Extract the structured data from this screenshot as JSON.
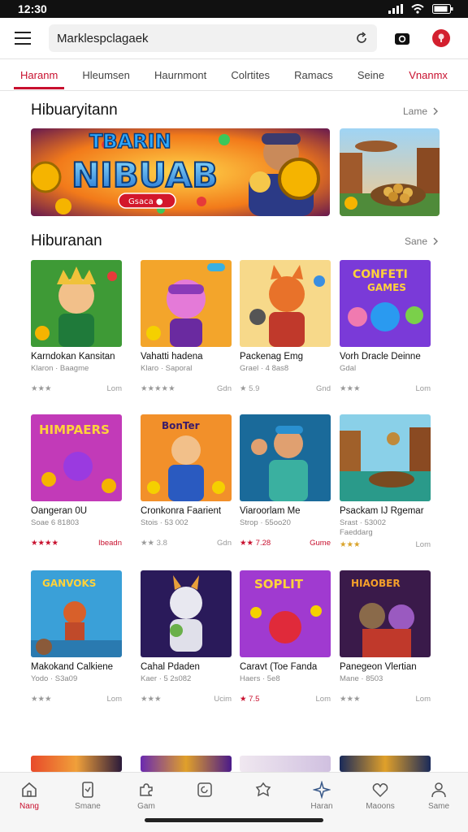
{
  "status": {
    "time": "12:30"
  },
  "topbar": {
    "search_value": "Marklespclagaek"
  },
  "tabs": [
    {
      "label": "Haranm",
      "active": true
    },
    {
      "label": "Hleumsen"
    },
    {
      "label": "Haurnmont"
    },
    {
      "label": "Colrtites"
    },
    {
      "label": "Ramacs"
    },
    {
      "label": "Seine"
    },
    {
      "label": "Vnanmx",
      "accent": true
    }
  ],
  "section1": {
    "title": "Hibuaryitann",
    "see_more": "Lame",
    "banner_title_top": "TBARIN",
    "banner_title": "NIBUAB",
    "banner_button": "Gsaca"
  },
  "section2": {
    "title": "Hiburanan",
    "see_more": "Sane"
  },
  "games": [
    {
      "title": "Karndokan Kansitan",
      "sub": "Klaron · Baagme",
      "stars": "★★★",
      "right": "Lom"
    },
    {
      "title": "Vahatti hadena",
      "sub": "Klaro · Saporal",
      "stars": "★★★★★",
      "right": "Gdn"
    },
    {
      "title": "Packenag Emg",
      "sub": "Grael · 4 8as8",
      "stars": "★ 5.9",
      "right": "Gnd"
    },
    {
      "title": "Vorh Dracle Deinne",
      "sub": "Gdal",
      "stars": "★★★",
      "right": "Lom"
    },
    {
      "title": "Oangeran 0U",
      "sub": "Soae 6 81803",
      "stars": "★★★★",
      "right": "Ibeadn",
      "red": true
    },
    {
      "title": "Cronkonra Faarient",
      "sub": "Stois · 53 002",
      "stars": "★★ 3.8",
      "right": "Gdn"
    },
    {
      "title": "Viaroorlam Me",
      "sub": "Strop · 55oo20",
      "stars": "★★ 7.28",
      "right": "Gume",
      "red": true
    },
    {
      "title": "Psackam IJ Rgemar",
      "sub": "Srast · 53002",
      "sub2": "Faeddarg",
      "stars": "★★★",
      "right": "Lom"
    },
    {
      "title": "Makokand Calkiene",
      "sub": "Yodo · S3a09",
      "stars": "★★★",
      "right": "Lom"
    },
    {
      "title": "Cahal Pdaden",
      "sub": "Kaer · 5 2s082",
      "stars": "★★★",
      "right": "Ucim"
    },
    {
      "title": "Caravt (Toe Fanda",
      "sub": "Haers · 5e8",
      "stars": "★ 7.5",
      "right": "Lom",
      "red": true
    },
    {
      "title": "Panegeon Vlertian",
      "sub": "Mane · 8503",
      "stars": "★★★",
      "right": "Lom"
    }
  ],
  "nav": [
    {
      "label": "Nang",
      "icon": "home-icon",
      "active": true
    },
    {
      "label": "Smane",
      "icon": "phone-icon"
    },
    {
      "label": "Gam",
      "icon": "puzzle-icon"
    },
    {
      "label": "",
      "icon": "refresh-icon"
    },
    {
      "label": "",
      "icon": "gem-icon"
    },
    {
      "label": "Haran",
      "icon": "sparkle-icon"
    },
    {
      "label": "Maoons",
      "icon": "heart-icon"
    },
    {
      "label": "Same",
      "icon": "user-icon"
    }
  ],
  "colors": {
    "accent": "#c8102e"
  }
}
